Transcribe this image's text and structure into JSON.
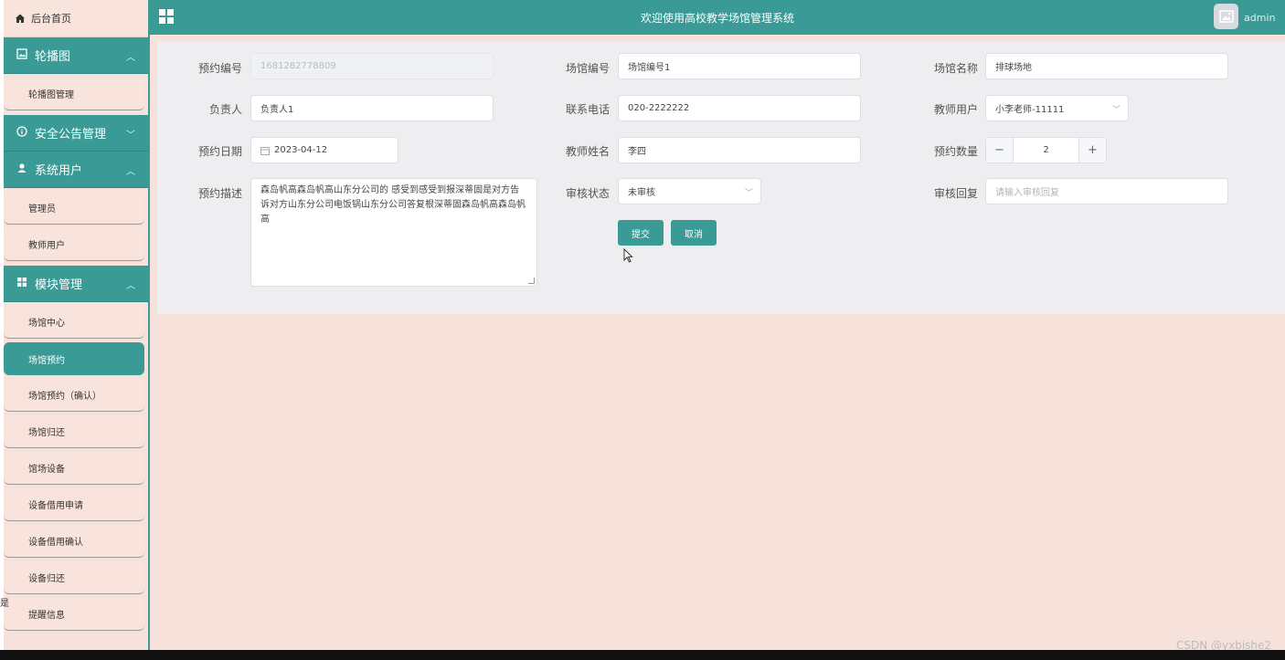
{
  "header": {
    "title": "欢迎使用高校教学场馆管理系统",
    "user": "admin"
  },
  "sidebar": {
    "home": "后台首页",
    "groups": [
      {
        "label": "轮播图",
        "items": [
          "轮播图管理"
        ]
      },
      {
        "label": "安全公告管理",
        "items": []
      },
      {
        "label": "系统用户",
        "items": [
          "管理员",
          "教师用户"
        ]
      },
      {
        "label": "模块管理",
        "items": [
          "场馆中心",
          "场馆预约",
          "场馆预约（确认）",
          "场馆归还",
          "馆场设备",
          "设备借用申请",
          "设备借用确认",
          "设备归还",
          "提醒信息"
        ]
      }
    ],
    "active": "场馆预约"
  },
  "form": {
    "booking_no": {
      "label": "预约编号",
      "value": "1681282778809"
    },
    "venue_no": {
      "label": "场馆编号",
      "value": "场馆编号1"
    },
    "venue_name": {
      "label": "场馆名称",
      "value": "排球场地"
    },
    "manager": {
      "label": "负责人",
      "value": "负责人1"
    },
    "phone": {
      "label": "联系电话",
      "value": "020-2222222"
    },
    "teacher_user": {
      "label": "教师用户",
      "value": "小李老师-11111"
    },
    "booking_date": {
      "label": "预约日期",
      "value": "2023-04-12"
    },
    "teacher_name": {
      "label": "教师姓名",
      "value": "李四"
    },
    "quantity": {
      "label": "预约数量",
      "value": "2"
    },
    "description": {
      "label": "预约描述",
      "value": "森岛帆高森岛帆高山东分公司的 感受到感受到报深蒂固是对方告诉对方山东分公司电饭锅山东分公司答复根深蒂固森岛帆高森岛帆高"
    },
    "review_status": {
      "label": "审核状态",
      "value": "未审核"
    },
    "review_reply": {
      "label": "审核回复",
      "placeholder": "请输入审核回复"
    },
    "submit": "提交",
    "cancel": "取消"
  },
  "watermark": "CSDN @yxbishe2",
  "stray_char": "是",
  "colors": {
    "accent": "#3a9a96",
    "background": "#f6e2da",
    "panel": "#eeedef"
  }
}
